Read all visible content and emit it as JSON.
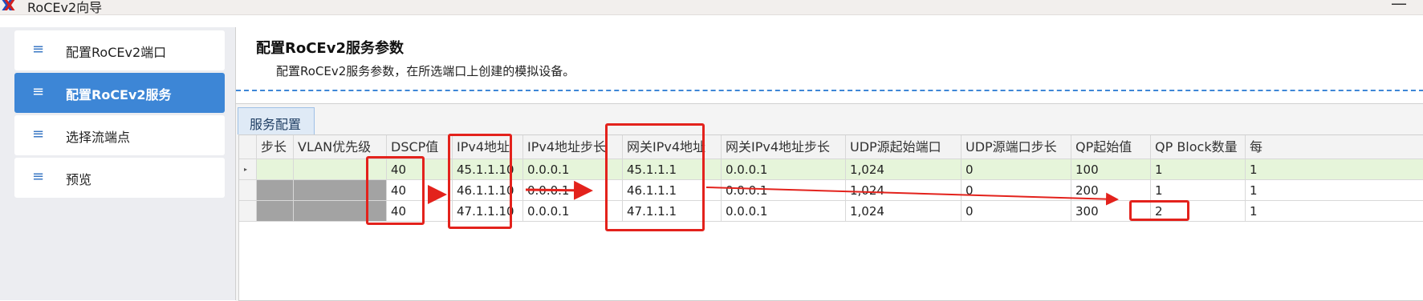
{
  "window": {
    "title": "RoCEv2向导",
    "logo_letter": "X",
    "minimize_glyph": "—"
  },
  "sidebar": {
    "items": [
      {
        "label": "配置RoCEv2端口",
        "active": false
      },
      {
        "label": "配置RoCEv2服务",
        "active": true
      },
      {
        "label": "选择流端点",
        "active": false
      },
      {
        "label": "预览",
        "active": false
      }
    ],
    "icon_glyph": "≡"
  },
  "main": {
    "title": "配置RoCEv2服务参数",
    "description": "配置RoCEv2服务参数，在所选端口上创建的模拟设备。",
    "tab_label": "服务配置"
  },
  "grid": {
    "columns": [
      "步长",
      "VLAN优先级",
      "DSCP值",
      "IPv4地址",
      "IPv4地址步长",
      "网关IPv4地址",
      "网关IPv4地址步长",
      "UDP源起始端口",
      "UDP源端口步长",
      "QP起始值",
      "QP Block数量",
      "每"
    ],
    "rows": [
      {
        "selected": true,
        "cells": [
          "",
          "",
          "40",
          "45.1.1.10",
          "0.0.0.1",
          "45.1.1.1",
          "0.0.0.1",
          "1,024",
          "0",
          "100",
          "1",
          "1"
        ]
      },
      {
        "selected": false,
        "cells": [
          "",
          "",
          "40",
          "46.1.1.10",
          "0.0.0.1",
          "46.1.1.1",
          "0.0.0.1",
          "1,024",
          "0",
          "200",
          "1",
          "1"
        ]
      },
      {
        "selected": false,
        "cells": [
          "",
          "",
          "40",
          "47.1.1.10",
          "0.0.0.1",
          "47.1.1.1",
          "0.0.0.1",
          "1,024",
          "0",
          "300",
          "2",
          "1"
        ]
      }
    ],
    "row_arrow": "▸"
  },
  "colors": {
    "accent": "#3d86d6",
    "selected_row": "#e6f5da",
    "annotation_red": "#e3221c"
  }
}
